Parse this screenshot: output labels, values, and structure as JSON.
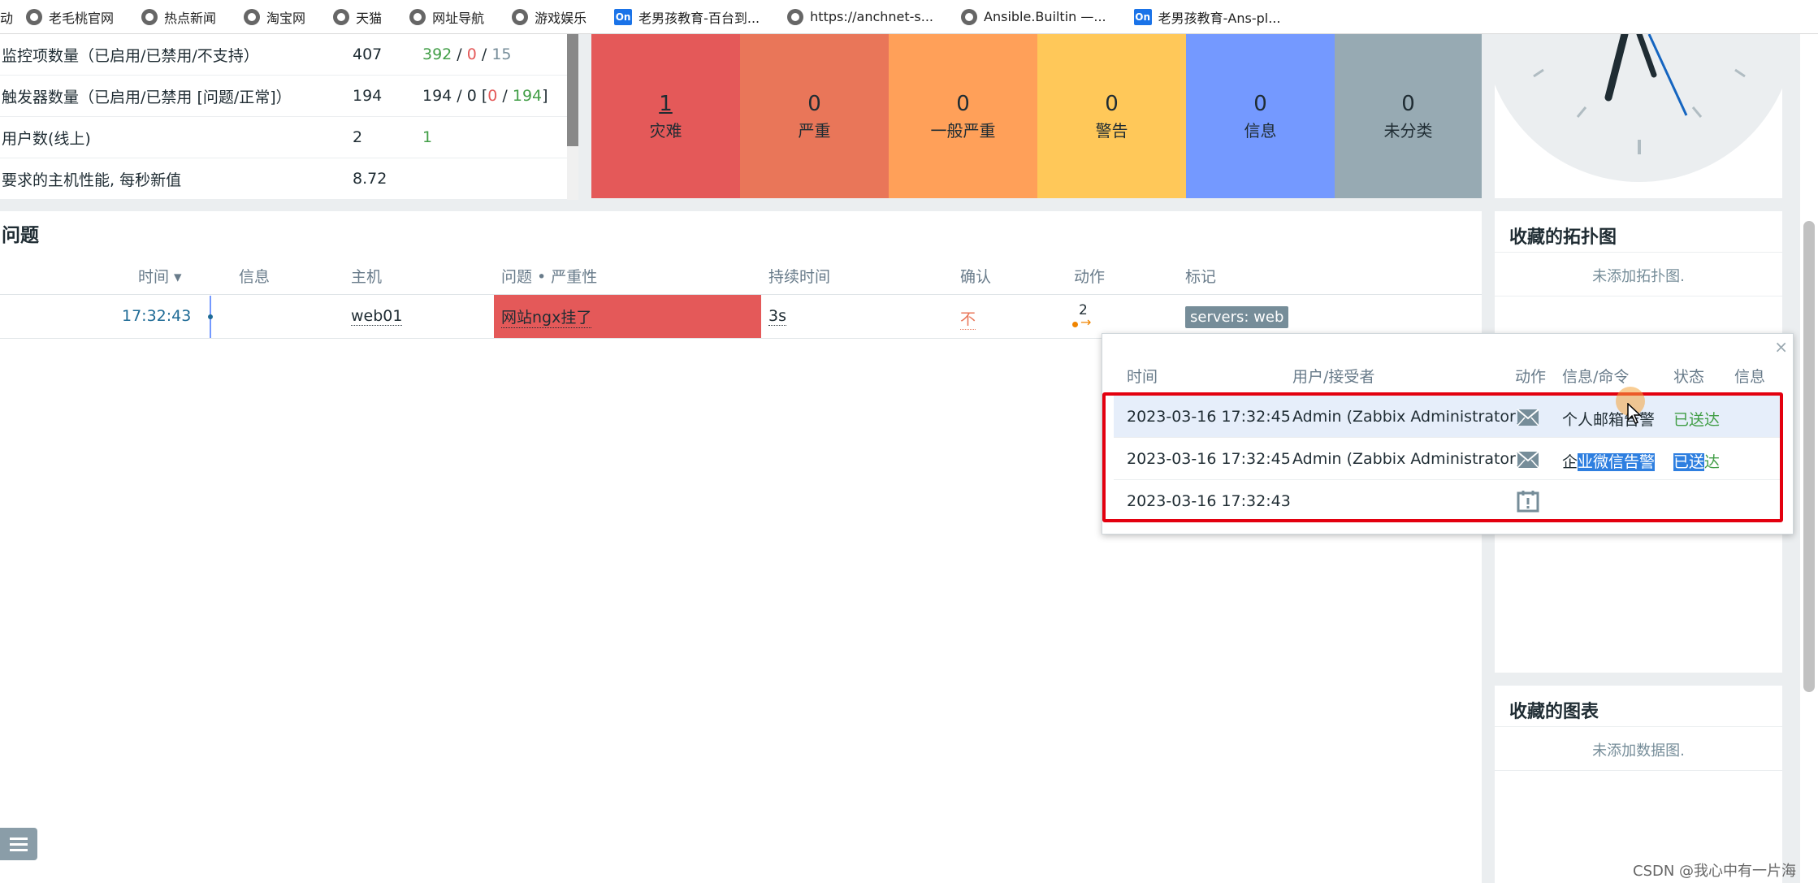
{
  "bookmarks": [
    {
      "label": "老毛桃官网",
      "icon": "globe-icon"
    },
    {
      "label": "热点新闻",
      "icon": "globe-icon"
    },
    {
      "label": "淘宝网",
      "icon": "globe-icon"
    },
    {
      "label": "天猫",
      "icon": "globe-icon"
    },
    {
      "label": "网址导航",
      "icon": "globe-icon"
    },
    {
      "label": "游戏娱乐",
      "icon": "globe-icon"
    },
    {
      "label": "老男孩教育-百台到...",
      "icon": "on-icon"
    },
    {
      "label": "https://anchnet-s...",
      "icon": "globe-icon"
    },
    {
      "label": "Ansible.Builtin —...",
      "icon": "globe-icon"
    },
    {
      "label": "老男孩教育-Ans-pl...",
      "icon": "on-icon"
    }
  ],
  "bookmark_prefix": "动",
  "on_badge": "On",
  "stats": [
    {
      "label": "监控项数量（已启用/已禁用/不支持）",
      "value": "407",
      "enabled": "392",
      "disabled": "0",
      "unsupported": "15"
    },
    {
      "label": "触发器数量（已启用/已禁用 [问题/正常]）",
      "value": "194",
      "enabled": "194 / 0 [",
      "problem": "0",
      "ok": "194",
      "close": "]"
    },
    {
      "label": "用户数(线上)",
      "value": "2",
      "online": "1"
    },
    {
      "label": "要求的主机性能, 每秒新值",
      "value": "8.72"
    }
  ],
  "severities": [
    {
      "count": "1",
      "label": "灾难",
      "color": "#e45959"
    },
    {
      "count": "0",
      "label": "严重",
      "color": "#e97659"
    },
    {
      "count": "0",
      "label": "一般严重",
      "color": "#ffa059"
    },
    {
      "count": "0",
      "label": "警告",
      "color": "#ffc859"
    },
    {
      "count": "0",
      "label": "信息",
      "color": "#7499ff"
    },
    {
      "count": "0",
      "label": "未分类",
      "color": "#97aab3"
    }
  ],
  "problems": {
    "title": "问题",
    "headers": {
      "time": "时间 ▾",
      "info": "信息",
      "host": "主机",
      "problem": "问题 • 严重性",
      "duration": "持续时间",
      "ack": "确认",
      "actions": "动作",
      "tags": "标记"
    },
    "row": {
      "time": "17:32:43",
      "host": "web01",
      "problem": "网站ngx挂了",
      "duration": "3s",
      "ack": "不",
      "actions": "2",
      "tag": "servers: web"
    }
  },
  "popup": {
    "close": "×",
    "headers": {
      "time": "时间",
      "user": "用户/接受者",
      "action": "动作",
      "message": "信息/命令",
      "status": "状态",
      "info": "信息"
    },
    "rows": [
      {
        "time": "2023-03-16 17:32:45",
        "user": "Admin (Zabbix Administrator)",
        "icon": "envelope-icon",
        "message": "个人邮箱告警",
        "status": "已送达"
      },
      {
        "time": "2023-03-16 17:32:45",
        "user": "Admin (Zabbix Administrator)",
        "icon": "envelope-icon",
        "message_a": "企",
        "message_b": "业微信告警",
        "status_a": "已送",
        "status_b": "达"
      },
      {
        "time": "2023-03-16 17:32:43",
        "user": "",
        "icon": "calendar-alert-icon"
      }
    ]
  },
  "favorites_maps": {
    "title": "收藏的拓扑图",
    "empty": "未添加拓扑图."
  },
  "favorites_graphs": {
    "title": "收藏的图表",
    "empty": "未添加数据图."
  },
  "watermark": "CSDN @我心中有一片海"
}
